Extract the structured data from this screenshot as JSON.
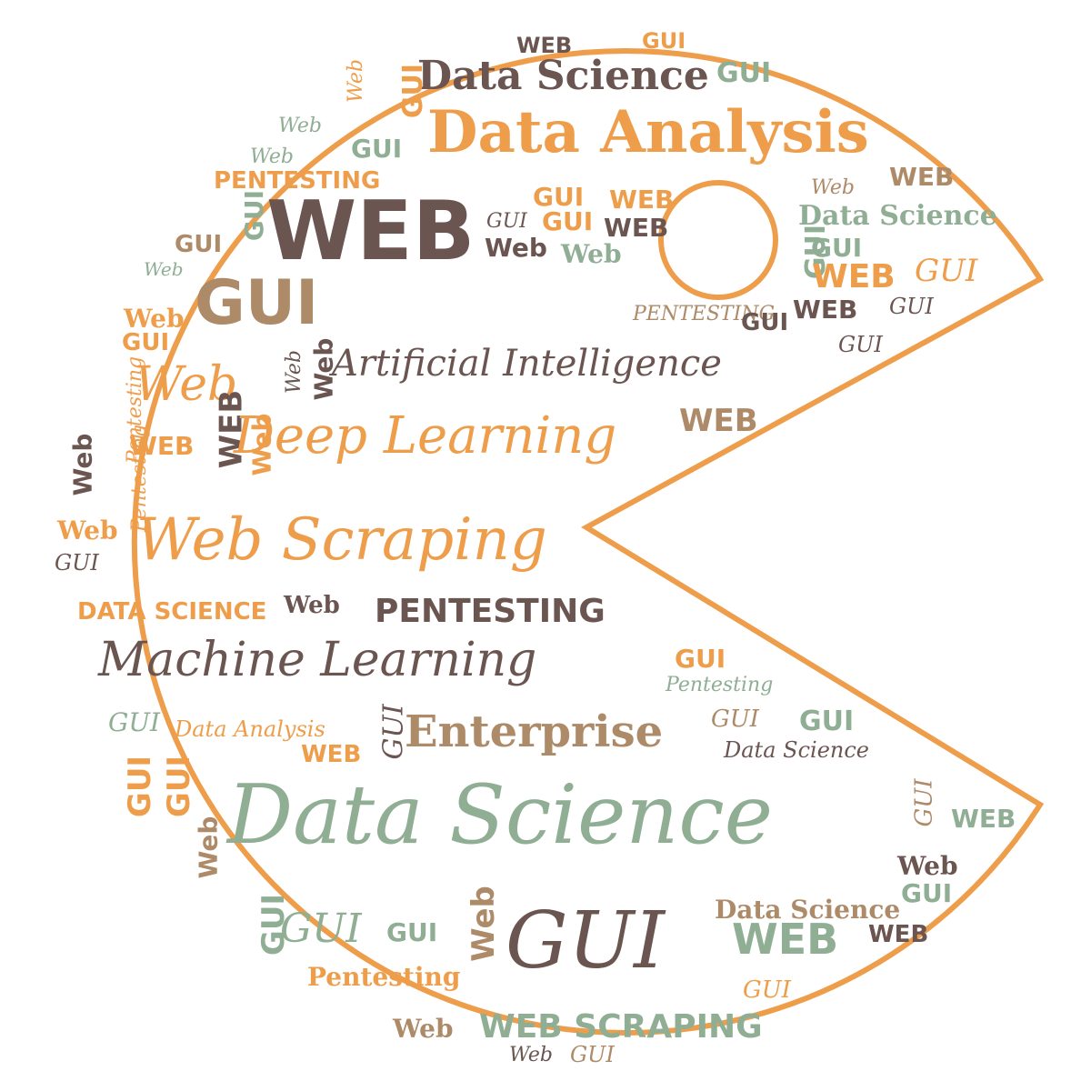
{
  "colors": {
    "outline": "#ee9d4b",
    "orange": "#ee9d4b",
    "brown": "#6b5551",
    "tan": "#ad8a68",
    "sage": "#8fae94",
    "background": "#ffffff"
  },
  "shape": "pac-man circle with mouth opening to the right and a round eye",
  "words": [
    {
      "text": "WEB",
      "color": "brown"
    },
    {
      "text": "GUI",
      "color": "orange"
    },
    {
      "text": "Data Science",
      "color": "brown"
    },
    {
      "text": "GUI",
      "color": "sage"
    },
    {
      "text": "Web",
      "color": "orange"
    },
    {
      "text": "GUI",
      "color": "orange"
    },
    {
      "text": "Web",
      "color": "sage"
    },
    {
      "text": "Data Analysis",
      "color": "orange"
    },
    {
      "text": "GUI",
      "color": "sage"
    },
    {
      "text": "Web",
      "color": "sage"
    },
    {
      "text": "PENTESTING",
      "color": "orange"
    },
    {
      "text": "WEB",
      "color": "tan"
    },
    {
      "text": "Web",
      "color": "tan"
    },
    {
      "text": "GUI",
      "color": "orange"
    },
    {
      "text": "WEB",
      "color": "orange"
    },
    {
      "text": "Data Science",
      "color": "sage"
    },
    {
      "text": "GUI",
      "color": "sage"
    },
    {
      "text": "WEB",
      "color": "brown"
    },
    {
      "text": "GUI",
      "color": "orange"
    },
    {
      "text": "WEB",
      "color": "brown"
    },
    {
      "text": "GUI",
      "color": "brown"
    },
    {
      "text": "GUI",
      "color": "tan"
    },
    {
      "text": "GUI",
      "color": "sage"
    },
    {
      "text": "Web",
      "color": "brown"
    },
    {
      "text": "Web",
      "color": "sage"
    },
    {
      "text": "Web",
      "color": "sage"
    },
    {
      "text": "GUI",
      "color": "sage"
    },
    {
      "text": "WEB",
      "color": "orange"
    },
    {
      "text": "GUI",
      "color": "orange"
    },
    {
      "text": "GUI",
      "color": "tan"
    },
    {
      "text": "PENTESTING",
      "color": "tan"
    },
    {
      "text": "Web",
      "color": "orange"
    },
    {
      "text": "GUI",
      "color": "brown"
    },
    {
      "text": "WEB",
      "color": "brown"
    },
    {
      "text": "GUI",
      "color": "brown"
    },
    {
      "text": "GUI",
      "color": "orange"
    },
    {
      "text": "GUI",
      "color": "brown"
    },
    {
      "text": "Web",
      "color": "orange"
    },
    {
      "text": "Artificial Intelligence",
      "color": "brown"
    },
    {
      "text": "Web",
      "color": "brown"
    },
    {
      "text": "Web",
      "color": "brown"
    },
    {
      "text": "WEB",
      "color": "tan"
    },
    {
      "text": "Pentesting",
      "color": "orange"
    },
    {
      "text": "WEB",
      "color": "brown"
    },
    {
      "text": "WEB",
      "color": "orange"
    },
    {
      "text": "Web",
      "color": "brown"
    },
    {
      "text": "Deep Learning",
      "color": "orange"
    },
    {
      "text": "Web",
      "color": "orange"
    },
    {
      "text": "Pentesting",
      "color": "orange"
    },
    {
      "text": "Web",
      "color": "orange"
    },
    {
      "text": "Web Scraping",
      "color": "orange"
    },
    {
      "text": "GUI",
      "color": "brown"
    },
    {
      "text": "DATA SCIENCE",
      "color": "orange"
    },
    {
      "text": "Web",
      "color": "brown"
    },
    {
      "text": "PENTESTING",
      "color": "brown"
    },
    {
      "text": "Machine Learning",
      "color": "brown"
    },
    {
      "text": "GUI",
      "color": "orange"
    },
    {
      "text": "Pentesting",
      "color": "sage"
    },
    {
      "text": "GUI",
      "color": "sage"
    },
    {
      "text": "Data Analysis",
      "color": "orange"
    },
    {
      "text": "GUI",
      "color": "brown"
    },
    {
      "text": "Enterprise",
      "color": "tan"
    },
    {
      "text": "GUI",
      "color": "tan"
    },
    {
      "text": "GUI",
      "color": "sage"
    },
    {
      "text": "WEB",
      "color": "orange"
    },
    {
      "text": "Data Science",
      "color": "brown"
    },
    {
      "text": "GUI",
      "color": "orange"
    },
    {
      "text": "GUI",
      "color": "orange"
    },
    {
      "text": "Data Science",
      "color": "sage"
    },
    {
      "text": "GUI",
      "color": "tan"
    },
    {
      "text": "WEB",
      "color": "sage"
    },
    {
      "text": "Web",
      "color": "tan"
    },
    {
      "text": "Web",
      "color": "brown"
    },
    {
      "text": "GUI",
      "color": "sage"
    },
    {
      "text": "GUI",
      "color": "sage"
    },
    {
      "text": "Web",
      "color": "tan"
    },
    {
      "text": "GUI",
      "color": "sage"
    },
    {
      "text": "GUI",
      "color": "sage"
    },
    {
      "text": "GUI",
      "color": "brown"
    },
    {
      "text": "Data Science",
      "color": "tan"
    },
    {
      "text": "WEB",
      "color": "sage"
    },
    {
      "text": "WEB",
      "color": "brown"
    },
    {
      "text": "Pentesting",
      "color": "orange"
    },
    {
      "text": "GUI",
      "color": "orange"
    },
    {
      "text": "Web",
      "color": "tan"
    },
    {
      "text": "WEB SCRAPING",
      "color": "sage"
    },
    {
      "text": "Web",
      "color": "brown"
    },
    {
      "text": "GUI",
      "color": "tan"
    }
  ]
}
